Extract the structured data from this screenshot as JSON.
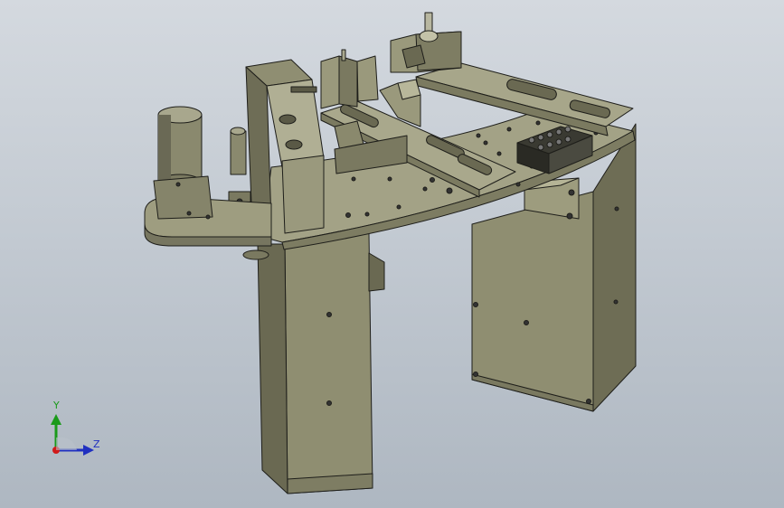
{
  "viewport": {
    "background_top": "#d4d9df",
    "background_bottom": "#aeb7c1",
    "model_color": "#8c8b6e",
    "model_edge_color": "#1e1e1a"
  },
  "triad": {
    "y_label": "Y",
    "z_label": "Z",
    "y_color": "#1a9a1a",
    "z_color": "#2030c0",
    "x_color": "#d01a1a"
  }
}
